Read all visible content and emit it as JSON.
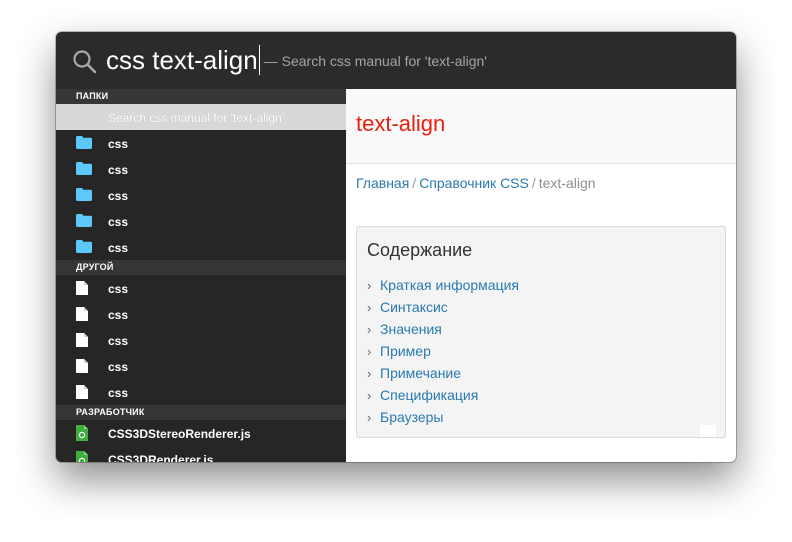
{
  "search": {
    "query": "css text-align",
    "hint": "— Search css manual for 'text-align'"
  },
  "sidebar": {
    "sections": [
      {
        "header": "ПАПКИ",
        "items": [
          {
            "label": "Search css manual for 'text-align'",
            "icon": "none",
            "selected": true
          },
          {
            "label": "css",
            "icon": "folder-icon"
          },
          {
            "label": "css",
            "icon": "folder-icon"
          },
          {
            "label": "css",
            "icon": "folder-icon"
          },
          {
            "label": "css",
            "icon": "folder-icon"
          },
          {
            "label": "css",
            "icon": "folder-icon"
          }
        ]
      },
      {
        "header": "ДРУГОЙ",
        "items": [
          {
            "label": "css",
            "icon": "file-icon"
          },
          {
            "label": "css",
            "icon": "file-icon"
          },
          {
            "label": "css",
            "icon": "file-icon"
          },
          {
            "label": "css",
            "icon": "file-icon"
          },
          {
            "label": "css",
            "icon": "file-icon"
          }
        ]
      },
      {
        "header": "РАЗРАБОТЧИК",
        "items": [
          {
            "label": "CSS3DStereoRenderer.js",
            "icon": "js-file-icon"
          },
          {
            "label": "CSS3DRenderer.js",
            "icon": "js-file-icon"
          }
        ]
      }
    ]
  },
  "doc": {
    "title": "text-align",
    "breadcrumb": {
      "home": "Главная",
      "sep": "/",
      "reference": "Справочник CSS",
      "current": "text-align"
    },
    "toc": {
      "title": "Содержание",
      "items": [
        "Краткая информация",
        "Синтаксис",
        "Значения",
        "Пример",
        "Примечание",
        "Спецификация",
        "Браузеры"
      ]
    }
  },
  "colors": {
    "title_red": "#e8200e",
    "link_blue": "#2a7aaf",
    "folder_blue": "#5ec8fa",
    "js_green": "#3fae3f",
    "sidebar_bg": "#262626",
    "section_bg": "#363636"
  }
}
